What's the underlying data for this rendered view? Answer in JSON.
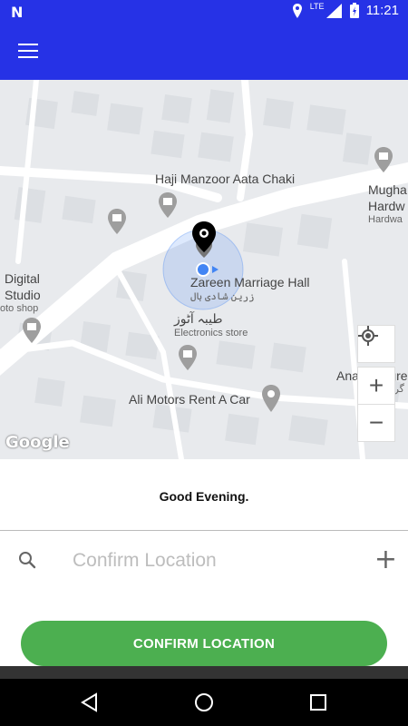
{
  "status_bar": {
    "notification_icon": "N",
    "network": "LTE",
    "time": "11:21"
  },
  "app_bar": {
    "menu_icon": "hamburger-menu-icon"
  },
  "map": {
    "labels": {
      "haji": "Haji Manzoor Aata Chaki",
      "mugha": "Mugha",
      "hardw": "Hardw",
      "hardwa": "Hardwa",
      "digital": "Digital",
      "studio": "Studio",
      "photo_shop": "oto shop",
      "zareen": "Zareen Marriage Hall",
      "zareen_ur": "زرین شادی ہال",
      "tayyaba_ur": "طیبہ آٹوز",
      "electronics": "Electronics store",
      "ali": "Ali Motors Rent A Car",
      "anam": "Anam Degre",
      "anam_ur": "گری"
    },
    "attribution": "Google",
    "controls": {
      "locate_icon": "gps-crosshair-icon",
      "zoom_in": "+",
      "zoom_out": "−"
    }
  },
  "greeting": "Good Evening.",
  "location_input": {
    "placeholder": "Confirm Location",
    "value": ""
  },
  "confirm_button": "CONFIRM LOCATION",
  "colors": {
    "app_bar": "#2632e6",
    "confirm": "#4caf50",
    "map_background": "#e8eaed"
  }
}
